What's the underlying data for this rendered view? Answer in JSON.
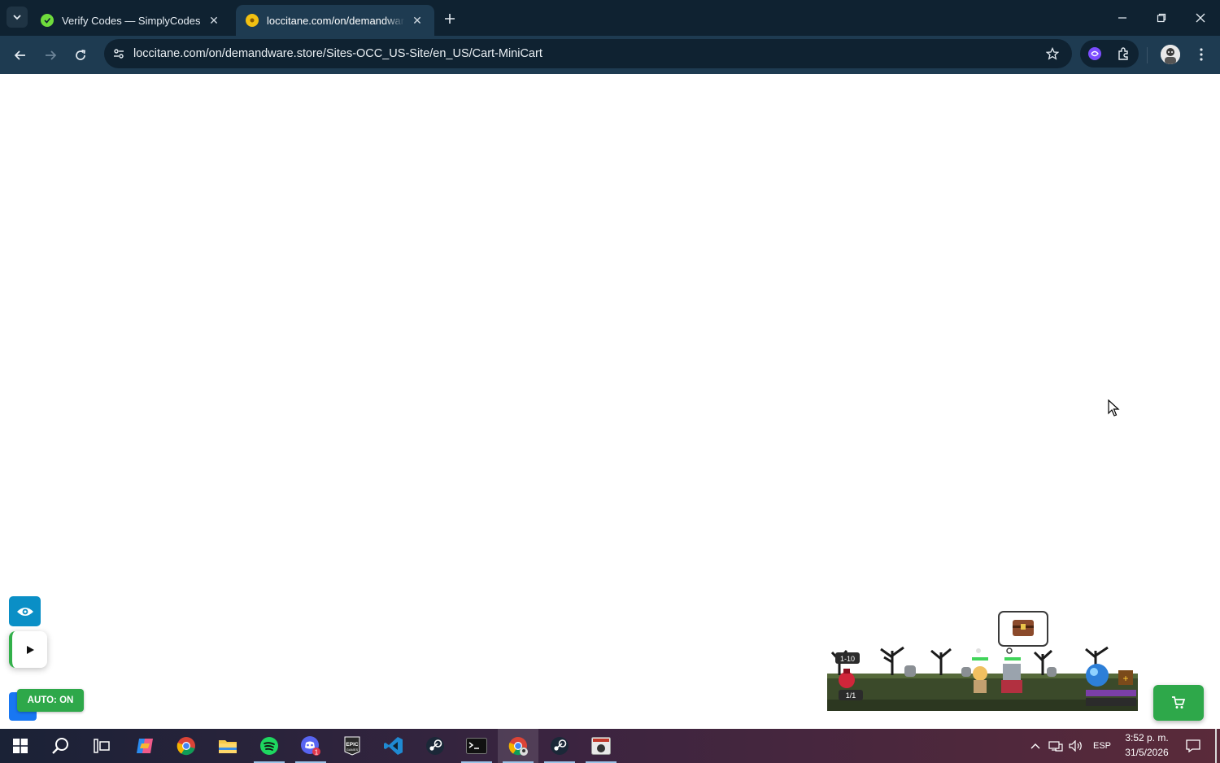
{
  "browser": {
    "tabs": [
      {
        "title": "Verify Codes — SimplyCodes",
        "active": false
      },
      {
        "title": "loccitane.com/on/demandware.store/Sites-OCC_US-Site/en_US/Cart-MiniCart",
        "active": true
      }
    ],
    "address_bar": {
      "url": "loccitane.com/on/demandware.store/Sites-OCC_US-Site/en_US/Cart-MiniCart"
    }
  },
  "page": {
    "widgets": {
      "auto_badge": "AUTO: ON",
      "game_level": "1-10",
      "game_counter": "1/1"
    }
  },
  "taskbar": {
    "language": "ESP",
    "time": "3:52 p. m.",
    "date": "31/5/2026",
    "spotify_badge": "1"
  },
  "colors": {
    "tabstrip": "#0f2231",
    "toolbar": "#1e3b51",
    "accent_green": "#2ea84a",
    "accent_blue": "#0a8fc6"
  }
}
